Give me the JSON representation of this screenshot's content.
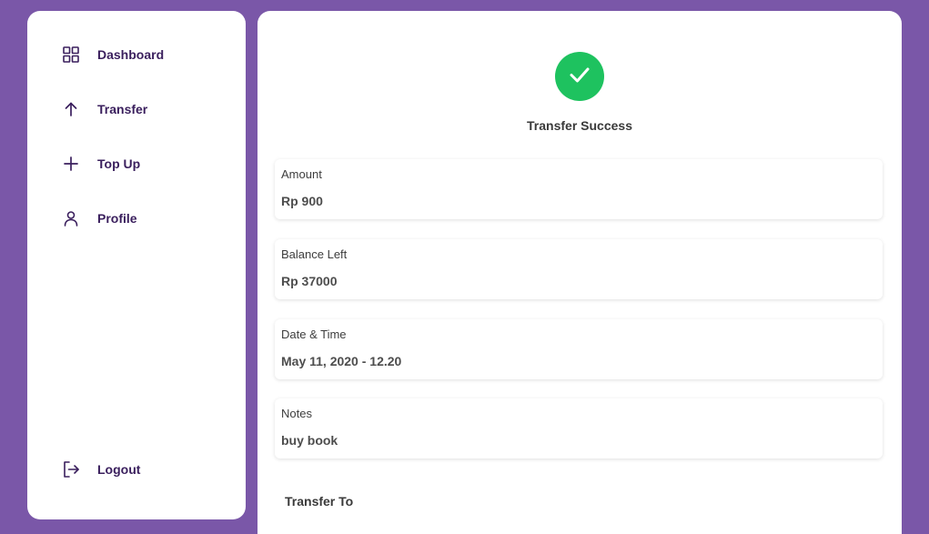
{
  "sidebar": {
    "items": [
      {
        "label": "Dashboard",
        "icon": "grid-icon"
      },
      {
        "label": "Transfer",
        "icon": "arrow-up-icon"
      },
      {
        "label": "Top Up",
        "icon": "plus-icon"
      },
      {
        "label": "Profile",
        "icon": "user-icon"
      }
    ],
    "logout": {
      "label": "Logout",
      "icon": "logout-icon"
    }
  },
  "main": {
    "status": {
      "title": "Transfer Success",
      "icon": "check-icon",
      "color": "#1ec25f"
    },
    "details": [
      {
        "label": "Amount",
        "value": "Rp 900"
      },
      {
        "label": "Balance Left",
        "value": "Rp 37000"
      },
      {
        "label": "Date & Time",
        "value": "May 11, 2020 - 12.20"
      },
      {
        "label": "Notes",
        "value": "buy book"
      }
    ],
    "transfer_to_title": "Transfer To"
  },
  "colors": {
    "background": "#7a57a8",
    "nav_text": "#3a1f5d",
    "success": "#1ec25f"
  }
}
